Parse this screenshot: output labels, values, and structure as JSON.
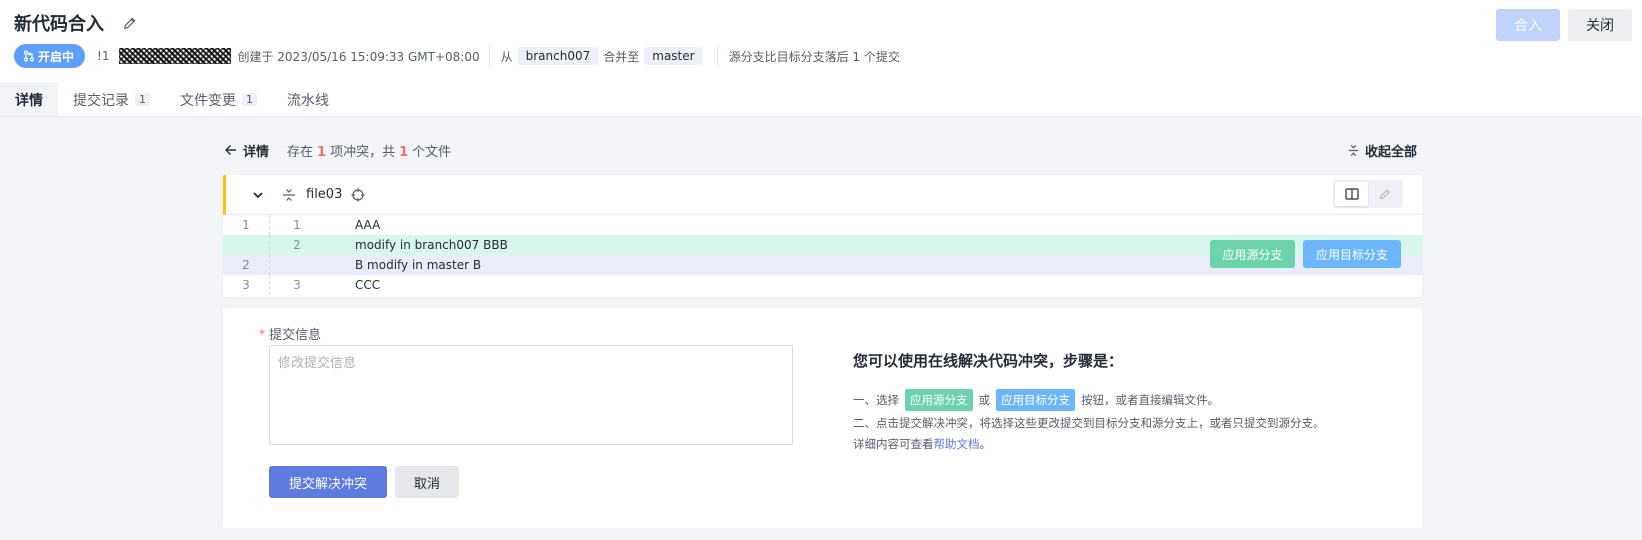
{
  "header": {
    "title": "新代码合入",
    "status": "开启中",
    "mr_id": "!1",
    "created": "创建于 2023/05/16 15:09:33 GMT+08:00",
    "from_label": "从",
    "source_branch": "branch007",
    "merge_to_label": "合并至",
    "target_branch": "master",
    "behind_text": "源分支比目标分支落后 1 个提交",
    "merge_button": "合入",
    "close_button": "关闭"
  },
  "tabs": [
    {
      "label": "详情",
      "count": ""
    },
    {
      "label": "提交记录",
      "count": "1"
    },
    {
      "label": "文件变更",
      "count": "1"
    },
    {
      "label": "流水线",
      "count": ""
    }
  ],
  "conflict_bar": {
    "back_label": "详情",
    "summary_prefix": "存在",
    "conflict_count": "1",
    "summary_middle": "项冲突，共",
    "file_count": "1",
    "summary_suffix": "个文件",
    "collapse_all": "收起全部"
  },
  "file": {
    "name": "file03",
    "lines": [
      {
        "ln_left": "1",
        "ln_right": "1",
        "text": "AAA",
        "kind": "normal"
      },
      {
        "ln_left": "",
        "ln_right": "2",
        "text": "modify in branch007 BBB",
        "kind": "src"
      },
      {
        "ln_left": "2",
        "ln_right": "",
        "text": "B modify in master B",
        "kind": "tgt"
      },
      {
        "ln_left": "3",
        "ln_right": "3",
        "text": "CCC",
        "kind": "normal"
      }
    ],
    "apply_source": "应用源分支",
    "apply_target": "应用目标分支"
  },
  "commit": {
    "label": "提交信息",
    "required_mark": "*",
    "placeholder": "修改提交信息",
    "submit": "提交解决冲突",
    "cancel": "取消"
  },
  "help": {
    "title": "您可以使用在线解决代码冲突，步骤是：",
    "line1_prefix": "一、选择",
    "tag_source": "应用源分支",
    "line1_or": "或",
    "tag_target": "应用目标分支",
    "line1_suffix": "按钮，或者直接编辑文件。",
    "line2": "二、点击提交解决冲突，将选择这些更改提交到目标分支和源分支上，或者只提交到源分支。",
    "line3_prefix": "详细内容可查看",
    "line3_link": "帮助文档",
    "line3_suffix": "。"
  },
  "colors": {
    "accent": "#5e7ce0",
    "status": "#5e9efc",
    "source": "#6cd3ac",
    "target": "#6cb6fb",
    "conflict_marker": "#fac20a",
    "danger": "#f66f6a"
  }
}
